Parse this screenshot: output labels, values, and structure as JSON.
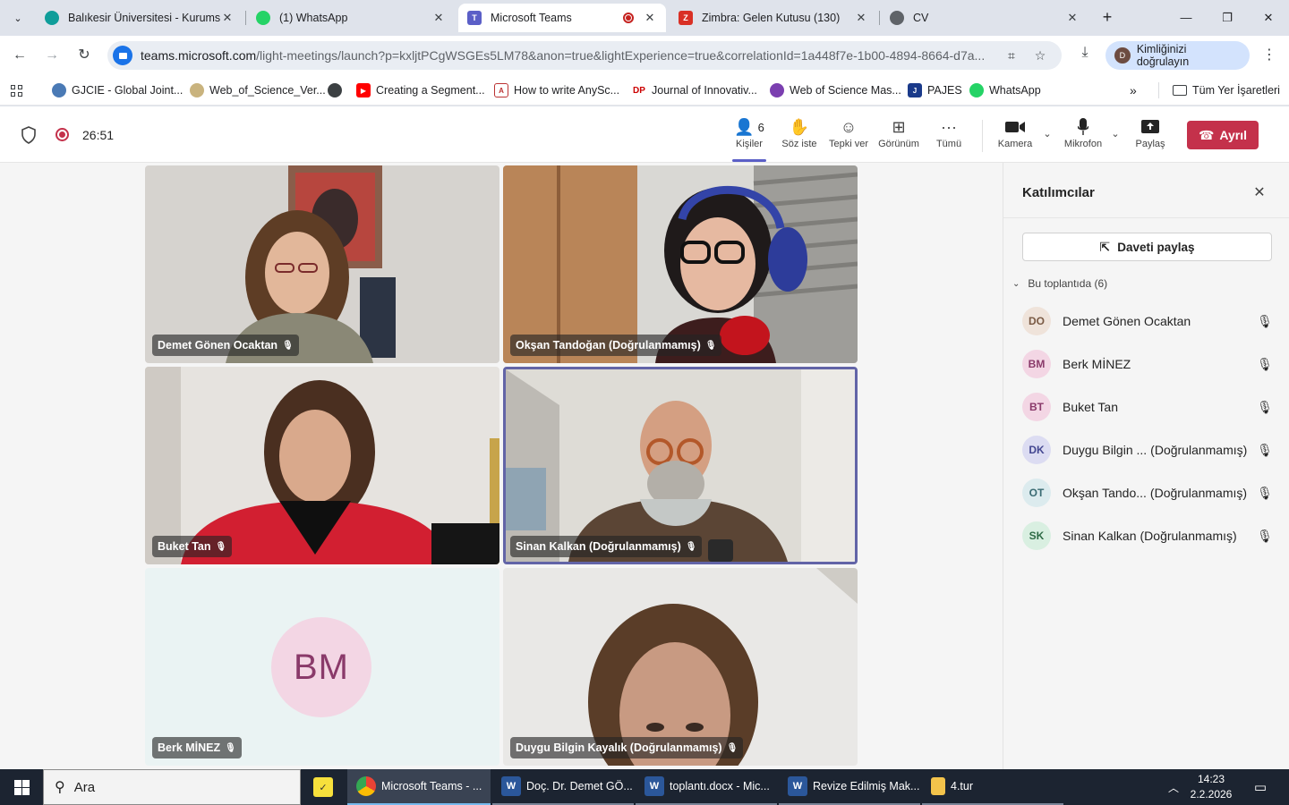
{
  "browser": {
    "tabs": [
      {
        "title": "Balıkesir Üniversitesi - Kurumsal",
        "favicon_color": "#0f9d9a"
      },
      {
        "title": "(1) WhatsApp",
        "favicon_color": "#25d366"
      },
      {
        "title": "Microsoft Teams",
        "favicon_color": "#5b5fc7"
      },
      {
        "title": "Zimbra: Gelen Kutusu (130)",
        "favicon_color": "#d93025"
      },
      {
        "title": "CV",
        "favicon_color": "#5f6368"
      }
    ],
    "url_host": "teams.microsoft.com",
    "url_rest": "/light-meetings/launch?p=kxljtPCgWSGEs5LM78&anon=true&lightExperience=true&correlationId=1a448f7e-1b00-4894-8664-d7a...",
    "profile_label": "Kimliğinizi doğrulayın",
    "profile_initial": "D",
    "bookmarks": [
      {
        "label": "GJCIE - Global Joint...",
        "icon": "globe-logo-icon"
      },
      {
        "label": "Web_of_Science_Ver...",
        "icon": "seal-icon"
      },
      {
        "label": "",
        "icon": "globe-icon"
      },
      {
        "label": "Creating a Segment...",
        "icon": "youtube-icon"
      },
      {
        "label": "How to write AnySc...",
        "icon": "doc-icon"
      },
      {
        "label": "Journal of Innovativ...",
        "icon": "dp-icon"
      },
      {
        "label": "Web of Science Mas...",
        "icon": "clarivate-icon"
      },
      {
        "label": "PAJES",
        "icon": "pajes-icon"
      },
      {
        "label": "WhatsApp",
        "icon": "whatsapp-icon"
      }
    ],
    "all_bookmarks": "Tüm Yer İşaretleri"
  },
  "meeting": {
    "timer": "26:51",
    "people_count": "6",
    "buttons": {
      "people": "Kişiler",
      "raise": "Söz iste",
      "react": "Tepki ver",
      "view": "Görünüm",
      "more": "Tümü",
      "camera": "Kamera",
      "mic": "Mikrofon",
      "share": "Paylaş",
      "leave": "Ayrıl"
    },
    "tiles": [
      {
        "name": "Demet Gönen Ocaktan"
      },
      {
        "name": "Okşan Tandoğan (Doğrulanmamış)"
      },
      {
        "name": "Buket Tan"
      },
      {
        "name": "Sinan Kalkan (Doğrulanmamış)"
      },
      {
        "name": "Berk MİNEZ",
        "initials": "BM"
      },
      {
        "name": "Duygu Bilgin Kayalık (Doğrulanmamış)"
      }
    ]
  },
  "pane": {
    "title": "Katılımcılar",
    "invite": "Daveti paylaş",
    "section": "Bu toplantıda (6)",
    "participants": [
      {
        "initials": "DO",
        "name": "Demet Gönen Ocaktan",
        "tag": "",
        "bg": "#efe3da",
        "fg": "#7a5a44"
      },
      {
        "initials": "BM",
        "name": "Berk MİNEZ",
        "tag": "",
        "bg": "#f3d6e4",
        "fg": "#8a3a6a"
      },
      {
        "initials": "BT",
        "name": "Buket Tan",
        "tag": "",
        "bg": "#f3d6e4",
        "fg": "#8a3a6a"
      },
      {
        "initials": "DK",
        "name": "Duygu Bilgin ...",
        "tag": "(Doğrulanmamış)",
        "bg": "#dcdcf2",
        "fg": "#444791"
      },
      {
        "initials": "OT",
        "name": "Okşan Tando...",
        "tag": "(Doğrulanmamış)",
        "bg": "#dcebee",
        "fg": "#3a6b73"
      },
      {
        "initials": "SK",
        "name": "Sinan Kalkan",
        "tag": "(Doğrulanmamış)",
        "bg": "#d9efe1",
        "fg": "#2f6b46"
      }
    ]
  },
  "taskbar": {
    "search_placeholder": "Ara",
    "apps": [
      {
        "label": "Microsoft Teams - ...",
        "icon": "chrome-icon"
      },
      {
        "label": "Doç. Dr. Demet GÖ...",
        "icon": "word-icon"
      },
      {
        "label": "toplantı.docx - Mic...",
        "icon": "word-icon"
      },
      {
        "label": "Revize Edilmiş Mak...",
        "icon": "word-icon"
      },
      {
        "label": "4.tur",
        "icon": "folder-icon"
      }
    ],
    "time": "14:23",
    "date": "2.2.2026"
  }
}
